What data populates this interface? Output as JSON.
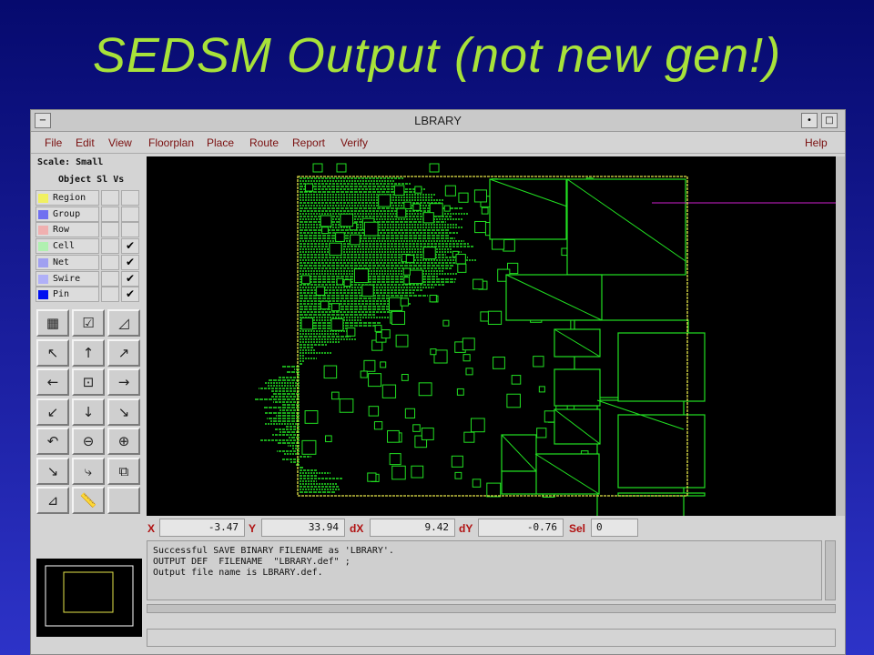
{
  "slide": {
    "title": "SEDSM Output (not new gen!)"
  },
  "window": {
    "title": "LBRARY"
  },
  "menu": {
    "left": [
      "File",
      "Edit",
      "View",
      "Floorplan",
      "Place",
      "Route",
      "Report",
      "Verify"
    ],
    "right": "Help"
  },
  "side_panel": {
    "scale_label": "Scale: Small",
    "object_header": "Object Sl Vs",
    "layers": [
      {
        "name": "Region",
        "color": "#f0f060",
        "visible": false
      },
      {
        "name": "Group",
        "color": "#7070f0",
        "visible": false
      },
      {
        "name": "Row",
        "color": "#f0b0b0",
        "visible": false
      },
      {
        "name": "Cell",
        "color": "#b0f0b0",
        "visible": true
      },
      {
        "name": "Net",
        "color": "#a0a0f0",
        "visible": true
      },
      {
        "name": "Swire",
        "color": "#b0b0f8",
        "visible": true
      },
      {
        "name": "Pin",
        "color": "#0010f0",
        "visible": true
      }
    ],
    "check_mark": "✔"
  },
  "toolbar": {
    "tools": [
      {
        "name": "grid-tool-icon",
        "glyph": "▦"
      },
      {
        "name": "check-list-icon",
        "glyph": "☑"
      },
      {
        "name": "ruler-corner-icon",
        "glyph": "◿"
      },
      {
        "name": "pan-up-left-icon",
        "glyph": "↖"
      },
      {
        "name": "pan-up-icon",
        "glyph": "↑"
      },
      {
        "name": "pan-up-right-icon",
        "glyph": "↗"
      },
      {
        "name": "pan-left-icon",
        "glyph": "←"
      },
      {
        "name": "fit-view-icon",
        "glyph": "⊡"
      },
      {
        "name": "pan-right-icon",
        "glyph": "→"
      },
      {
        "name": "pan-down-left-icon",
        "glyph": "↙"
      },
      {
        "name": "pan-down-icon",
        "glyph": "↓"
      },
      {
        "name": "pan-down-right-icon",
        "glyph": "↘"
      },
      {
        "name": "undo-view-icon",
        "glyph": "↶"
      },
      {
        "name": "zoom-out-icon",
        "glyph": "⊖"
      },
      {
        "name": "zoom-in-icon",
        "glyph": "⊕"
      },
      {
        "name": "select-arrow-icon",
        "glyph": "↘"
      },
      {
        "name": "route-step-icon",
        "glyph": "⤷"
      },
      {
        "name": "window-select-icon",
        "glyph": "⧉"
      },
      {
        "name": "measure-icon",
        "glyph": "⊿"
      },
      {
        "name": "ruler-icon",
        "glyph": "📏"
      },
      {
        "name": "blank-tool",
        "glyph": ""
      }
    ]
  },
  "coords": {
    "x_label": "X",
    "x_value": "-3.47",
    "y_label": "Y",
    "y_value": "33.94",
    "dx_label": "dX",
    "dx_value": "9.42",
    "dy_label": "dY",
    "dy_value": "-0.76",
    "sel_label": "Sel",
    "sel_value": "0"
  },
  "messages": [
    "Successful SAVE BINARY FILENAME as 'LBRARY'.",
    "OUTPUT DEF  FILENAME  \"LBRARY.def\" ;",
    "Output file name is LBRARY.def."
  ],
  "colors": {
    "layout_green": "#22e022",
    "die_outline": "#e6e64a",
    "net_magenta": "#d020d0"
  }
}
